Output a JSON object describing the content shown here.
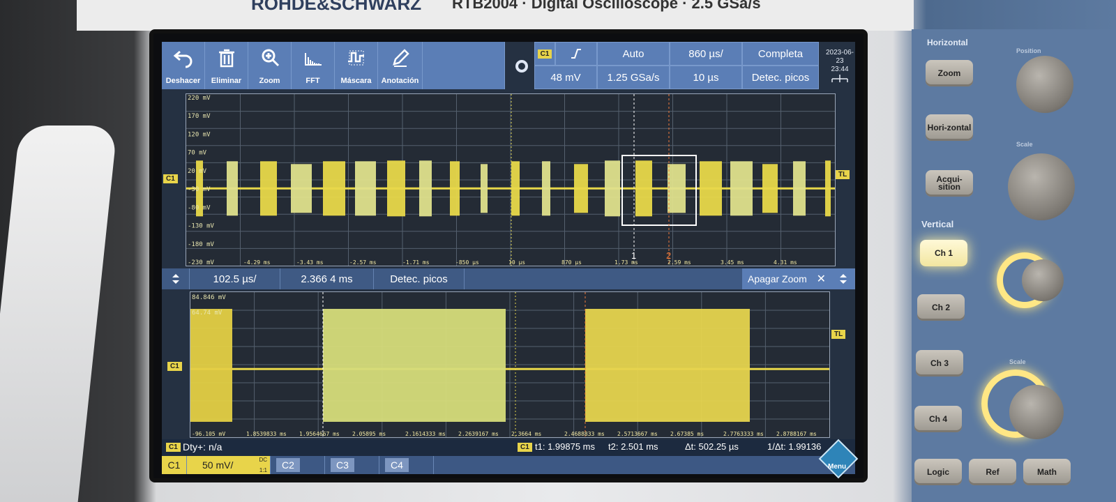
{
  "device": {
    "brand": "ROHDE&SCHWARZ",
    "model": "RTB2004 · Digital Oscilloscope · 2.5 GSa/s"
  },
  "toolbar": [
    {
      "label": "Deshacer",
      "icon": "undo-icon"
    },
    {
      "label": "Eliminar",
      "icon": "trash-icon"
    },
    {
      "label": "Zoom",
      "icon": "zoom-icon"
    },
    {
      "label": "FFT",
      "icon": "fft-icon"
    },
    {
      "label": "Máscara",
      "icon": "mask-icon"
    },
    {
      "label": "Anotación",
      "icon": "pencil-icon"
    }
  ],
  "trigger": {
    "channel": "C1",
    "slope": "rising-edge-icon",
    "mode": "Auto",
    "level": "48 mV",
    "sample_rate": "1.25 GSa/s",
    "time_per_div": "860 µs/",
    "position": "10 µs",
    "acquisition": "Completa",
    "acq_mode": "Detec. picos"
  },
  "datetime": {
    "date": "2023-06-23",
    "time": "23:44"
  },
  "main_plot": {
    "channel_tag": "C1",
    "trigger_tag": "TL",
    "y_labels": [
      "220 mV",
      "170 mV",
      "120 mV",
      "70 mV",
      "20 mV",
      "-30 mV",
      "-80 mV",
      "-130 mV",
      "-180 mV",
      "-230 mV"
    ],
    "x_labels": [
      "-4.29 ms",
      "-3.43 ms",
      "-2.57 ms",
      "-1.71 ms",
      "-850 µs",
      "10 µs",
      "870 µs",
      "1.73 ms",
      "2.59 ms",
      "3.45 ms",
      "4.31 ms"
    ],
    "cursor1": "1",
    "cursor2": "2"
  },
  "zoom_bar": {
    "time_per_div": "102.5 µs/",
    "position": "2.366 4 ms",
    "acq_mode": "Detec. picos",
    "close_label": "Apagar Zoom",
    "close_icon": "close-icon"
  },
  "zoom_plot": {
    "channel_tag": "C1",
    "trigger_tag": "TL",
    "y_top": "84.846 mV",
    "y_second": "64.74 mV",
    "y_bottom": "-96.105 mV",
    "x_labels": [
      "1.8539833 ms",
      "1.9564667 ms",
      "2.05895 ms",
      "2.1614333 ms",
      "2.2639167 ms",
      "2.3664 ms",
      "2.4688833 ms",
      "2.5713667 ms",
      "2.67385 ms",
      "2.7763333 ms",
      "2.8788167 ms"
    ]
  },
  "measure": {
    "channel": "C1",
    "label": "Dty+: n/a"
  },
  "cursors": {
    "channel": "C1",
    "t1": "t1: 1.99875 ms",
    "t2": "t2: 2.501 ms",
    "dt": "Δt: 502.25 µs",
    "inv_dt": "1/Δt: 1.99136 kHz"
  },
  "channels": {
    "c1": "C1",
    "c1_scale": "50 mV/",
    "c1_coupling": "DC",
    "c1_imp": "1:1",
    "c2": "C2",
    "c3": "C3",
    "c4": "C4",
    "menu": "Menu"
  },
  "panel": {
    "horizontal": "Horizontal",
    "position": "Position",
    "scale_h": "Scale",
    "zoom": "Zoom",
    "hori": "Hori-zontal",
    "acqui": "Acqui-sition",
    "vertical": "Vertical",
    "scale_v": "Scale",
    "ch1": "Ch 1",
    "ch2": "Ch 2",
    "ch3": "Ch 3",
    "ch4": "Ch 4",
    "logic": "Logic",
    "ref": "Ref",
    "math": "Math"
  },
  "colors": {
    "accent": "#5b7eb6",
    "trace": "#e8d84a",
    "trace_green": "#b9d86a",
    "background": "#242b35"
  }
}
